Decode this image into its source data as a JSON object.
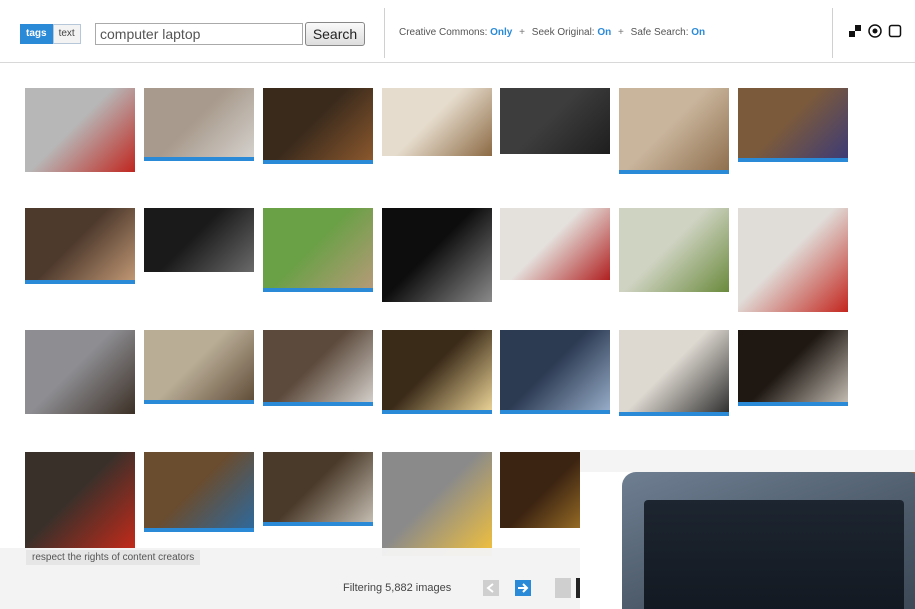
{
  "header": {
    "mode_toggle": {
      "tags_label": "tags",
      "text_label": "text"
    },
    "search": {
      "value": "computer laptop",
      "button_label": "Search"
    },
    "filters": [
      {
        "label": "Creative Commons:",
        "value": "Only"
      },
      {
        "label": "Seek Original:",
        "value": "On"
      },
      {
        "label": "Safe Search:",
        "value": "On"
      }
    ],
    "separator": "+"
  },
  "grid": {
    "thumbnails": [
      {
        "name": "man-red-sofa-laptop",
        "c1": "#b7b7b7",
        "c2": "#c0261f"
      },
      {
        "name": "cat-on-macbook",
        "c1": "#a89a8c",
        "c2": "#d6d3cf"
      },
      {
        "name": "desk-room-laptop",
        "c1": "#3a2a1c",
        "c2": "#8e5a2e"
      },
      {
        "name": "laptop-on-desk",
        "c1": "#e6dccd",
        "c2": "#8c6a44"
      },
      {
        "name": "macbook-lid-dark",
        "c1": "#3d3d3d",
        "c2": "#1e1e1e"
      },
      {
        "name": "woman-floor-laptop",
        "c1": "#c9b59c",
        "c2": "#8d6d4b"
      },
      {
        "name": "cat-purple-laptop",
        "c1": "#7b5a3b",
        "c2": "#3b3a78"
      },
      {
        "name": "feet-laptop",
        "c1": "#4e3a2d",
        "c2": "#c49a76"
      },
      {
        "name": "laptop-dark-table",
        "c1": "#1a1a1a",
        "c2": "#6a6a6a"
      },
      {
        "name": "girl-grass-fence",
        "c1": "#6aa046",
        "c2": "#b89a7a"
      },
      {
        "name": "hands-laptop-black",
        "c1": "#0d0d0d",
        "c2": "#8a8a8a"
      },
      {
        "name": "room-red-chair",
        "c1": "#e4e0dc",
        "c2": "#b02020"
      },
      {
        "name": "girl-laptop-frame",
        "c1": "#cfd3c2",
        "c2": "#6a8a3c"
      },
      {
        "name": "red-couch-room",
        "c1": "#e0dcd8",
        "c2": "#c3261e"
      },
      {
        "name": "imac-desk",
        "c1": "#8d8d92",
        "c2": "#3c3026"
      },
      {
        "name": "office-room",
        "c1": "#b9ad96",
        "c2": "#5e4a36"
      },
      {
        "name": "person-screens",
        "c1": "#5c4a3c",
        "c2": "#d8d4cf"
      },
      {
        "name": "laptop-glow-table",
        "c1": "#3a2a18",
        "c2": "#f0d89a"
      },
      {
        "name": "laptop-screen-blue",
        "c1": "#2c3a52",
        "c2": "#9ab0cc"
      },
      {
        "name": "man-standing-office",
        "c1": "#ddd8d0",
        "c2": "#2a2a2a"
      },
      {
        "name": "desk-dark-room",
        "c1": "#1e1712",
        "c2": "#c9c2b8"
      },
      {
        "name": "person-floor-red",
        "c1": "#3a302a",
        "c2": "#c22a1a"
      },
      {
        "name": "desk-lamp-laptop",
        "c1": "#6a4c2e",
        "c2": "#2c6aa0"
      },
      {
        "name": "laptops-table",
        "c1": "#4a3a2a",
        "c2": "#c9c2b6"
      },
      {
        "name": "egg-laptop",
        "c1": "#8a8a8a",
        "c2": "#f4c23a"
      },
      {
        "name": "shelves-room",
        "c1": "#3c2412",
        "c2": "#b8862c"
      }
    ]
  },
  "footer": {
    "rights_text": "respect the rights of content creators",
    "status_text": "Filtering 5,882 images"
  }
}
